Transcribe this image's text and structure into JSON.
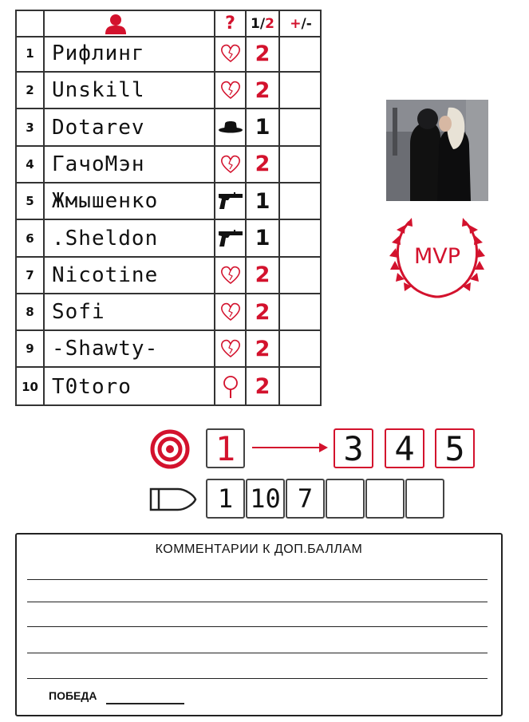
{
  "table": {
    "header": {
      "role_col": "?",
      "team_col_1": "1/",
      "team_col_2": "2",
      "score_col_plus": "+",
      "score_col_minus": "/-"
    },
    "rows": [
      {
        "num": "1",
        "name": "Рифлинг",
        "role": "heart-icon",
        "team": "2",
        "team_color": "red"
      },
      {
        "num": "2",
        "name": "Unskill",
        "role": "heart-icon",
        "team": "2",
        "team_color": "red"
      },
      {
        "num": "3",
        "name": "Dotarev",
        "role": "hat-icon",
        "team": "1",
        "team_color": "black"
      },
      {
        "num": "4",
        "name": "ГачоМэн",
        "role": "heart-icon",
        "team": "2",
        "team_color": "red"
      },
      {
        "num": "5",
        "name": "Жмышенко",
        "role": "pistol-icon",
        "team": "1",
        "team_color": "black"
      },
      {
        "num": "6",
        "name": ".Sheldon",
        "role": "pistol-icon",
        "team": "1",
        "team_color": "black"
      },
      {
        "num": "7",
        "name": "Nicotine",
        "role": "heart-icon",
        "team": "2",
        "team_color": "red"
      },
      {
        "num": "8",
        "name": "Sofi",
        "role": "heart-icon",
        "team": "2",
        "team_color": "red"
      },
      {
        "num": "9",
        "name": "-Shawty-",
        "role": "heart-icon",
        "team": "2",
        "team_color": "red"
      },
      {
        "num": "10",
        "name": "T0toro",
        "role": "magnifier-icon",
        "team": "2",
        "team_color": "red"
      }
    ]
  },
  "mvp": {
    "label": "MVP"
  },
  "targets": {
    "first": "1",
    "chain": [
      "3",
      "4",
      "5"
    ]
  },
  "shots": {
    "values": [
      "1",
      "10",
      "7",
      "",
      "",
      ""
    ]
  },
  "comments": {
    "title": "КОММЕНТАРИИ К ДОП.БАЛЛАМ",
    "win_label": "ПОБЕДА"
  },
  "colors": {
    "accent": "#d3122d",
    "border": "#333333"
  }
}
